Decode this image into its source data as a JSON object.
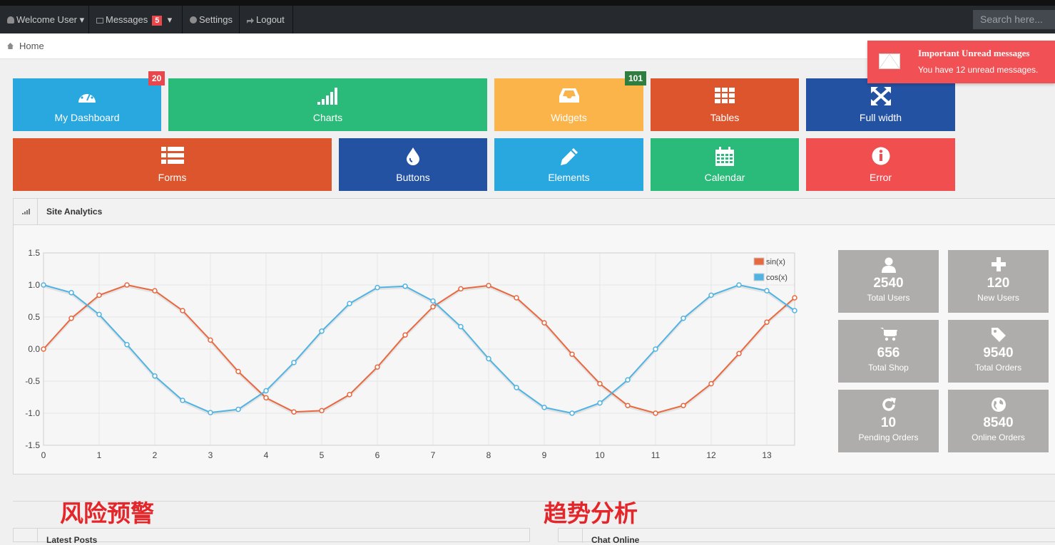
{
  "topbar": {
    "welcome": "Welcome User",
    "messages_label": "Messages",
    "messages_count": "5",
    "settings": "Settings",
    "logout": "Logout",
    "search_placeholder": "Search here..."
  },
  "breadcrumb": {
    "home": "Home"
  },
  "notification": {
    "title": "Important Unread messages",
    "body": "You have 12 unread messages."
  },
  "tiles": [
    {
      "label": "My Dashboard",
      "icon": "dashboard-gauge-icon",
      "badge": "20",
      "color": "#29a8e0"
    },
    {
      "label": "Charts",
      "icon": "signal-bars-icon",
      "color": "#2aba79"
    },
    {
      "label": "Widgets",
      "icon": "inbox-tray-icon",
      "badge": "101",
      "color": "#fbb449"
    },
    {
      "label": "Tables",
      "icon": "grid-table-icon",
      "color": "#dc552c"
    },
    {
      "label": "Full width",
      "icon": "expand-arrows-icon",
      "color": "#2352a3"
    },
    {
      "label": "Forms",
      "icon": "list-form-icon",
      "color": "#dc552c"
    },
    {
      "label": "Buttons",
      "icon": "droplet-icon",
      "color": "#2352a3"
    },
    {
      "label": "Elements",
      "icon": "pencil-icon",
      "color": "#29a8e0"
    },
    {
      "label": "Calendar",
      "icon": "calendar-icon",
      "color": "#2aba79"
    },
    {
      "label": "Error",
      "icon": "info-circle-icon",
      "color": "#f14e50"
    }
  ],
  "analytics": {
    "title": "Site Analytics",
    "stats": [
      {
        "value": "2540",
        "label": "Total Users",
        "icon": "user-icon"
      },
      {
        "value": "120",
        "label": "New Users",
        "icon": "plus-icon"
      },
      {
        "value": "656",
        "label": "Total Shop",
        "icon": "cart-icon"
      },
      {
        "value": "9540",
        "label": "Total Orders",
        "icon": "tag-icon"
      },
      {
        "value": "10",
        "label": "Pending Orders",
        "icon": "refresh-icon"
      },
      {
        "value": "8540",
        "label": "Online Orders",
        "icon": "globe-icon"
      }
    ]
  },
  "chart_data": {
    "type": "line",
    "xlim": [
      0,
      13.5
    ],
    "ylim": [
      -1.5,
      1.5
    ],
    "x_ticks": [
      "0",
      "1",
      "2",
      "3",
      "4",
      "5",
      "6",
      "7",
      "8",
      "9",
      "10",
      "11",
      "12",
      "13"
    ],
    "y_ticks": [
      "1.5",
      "1.0",
      "0.5",
      "0.0",
      "-0.5",
      "-1.0",
      "-1.5"
    ],
    "legend_position": "top-right",
    "grid": true,
    "x": [
      0,
      0.5,
      1,
      1.5,
      2,
      2.5,
      3,
      3.5,
      4,
      4.5,
      5,
      5.5,
      6,
      6.5,
      7,
      7.5,
      8,
      8.5,
      9,
      9.5,
      10,
      10.5,
      11,
      11.5,
      12,
      12.5,
      13,
      13.5
    ],
    "series": [
      {
        "name": "sin(x)",
        "color": "#e8683f",
        "values": [
          0.0,
          0.48,
          0.84,
          1.0,
          0.91,
          0.6,
          0.14,
          -0.35,
          -0.76,
          -0.98,
          -0.96,
          -0.71,
          -0.28,
          0.22,
          0.66,
          0.94,
          0.99,
          0.8,
          0.41,
          -0.08,
          -0.54,
          -0.88,
          -1.0,
          -0.88,
          -0.54,
          -0.07,
          0.42,
          0.8
        ]
      },
      {
        "name": "cos(x)",
        "color": "#4fb3e3",
        "values": [
          1.0,
          0.88,
          0.54,
          0.07,
          -0.42,
          -0.8,
          -0.99,
          -0.94,
          -0.65,
          -0.21,
          0.28,
          0.71,
          0.96,
          0.98,
          0.75,
          0.35,
          -0.15,
          -0.6,
          -0.91,
          -1.0,
          -0.84,
          -0.48,
          0.0,
          0.48,
          0.84,
          1.0,
          0.91,
          0.6
        ]
      }
    ]
  },
  "sections": {
    "left_title": "风险预警",
    "right_title": "趋势分析",
    "left_panel": "Latest Posts",
    "right_panel": "Chat Online"
  }
}
